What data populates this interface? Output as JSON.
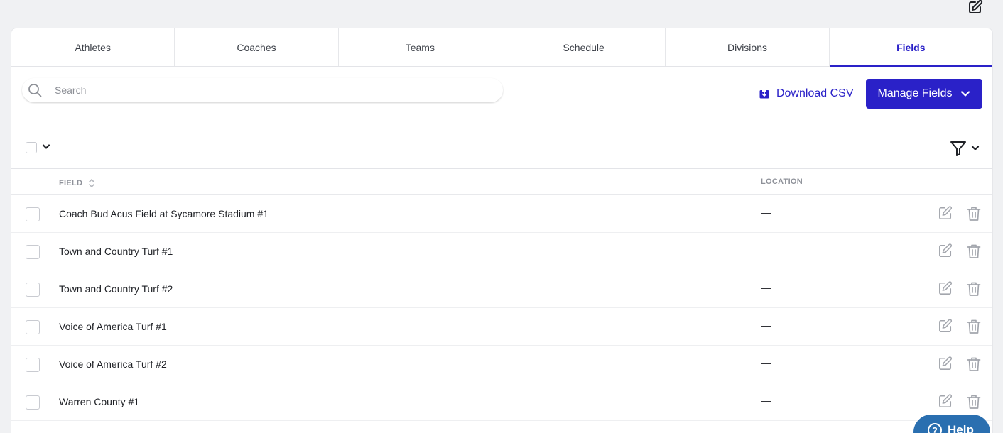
{
  "tabs": [
    {
      "label": "Athletes"
    },
    {
      "label": "Coaches"
    },
    {
      "label": "Teams"
    },
    {
      "label": "Schedule"
    },
    {
      "label": "Divisions"
    },
    {
      "label": "Fields",
      "active": true
    }
  ],
  "search": {
    "placeholder": "Search"
  },
  "toolbar": {
    "download_label": "Download CSV",
    "manage_label": "Manage Fields"
  },
  "table": {
    "columns": {
      "field": "FIELD",
      "location": "LOCATION"
    },
    "rows": [
      {
        "name": "Coach Bud Acus Field at Sycamore Stadium #1",
        "location": "—"
      },
      {
        "name": "Town and Country Turf #1",
        "location": "—"
      },
      {
        "name": "Town and Country Turf #2",
        "location": "—"
      },
      {
        "name": "Voice of America Turf #1",
        "location": "—"
      },
      {
        "name": "Voice of America Turf #2",
        "location": "—"
      },
      {
        "name": "Warren County #1",
        "location": "—"
      }
    ]
  },
  "help": {
    "label": "Help"
  },
  "colors": {
    "accent": "#2a21c8",
    "help": "#2a6fb0"
  },
  "icons": [
    "edit-icon",
    "search-icon",
    "download-icon",
    "chevron-down-icon",
    "filter-icon",
    "sort-icon",
    "trash-icon",
    "help-icon"
  ]
}
